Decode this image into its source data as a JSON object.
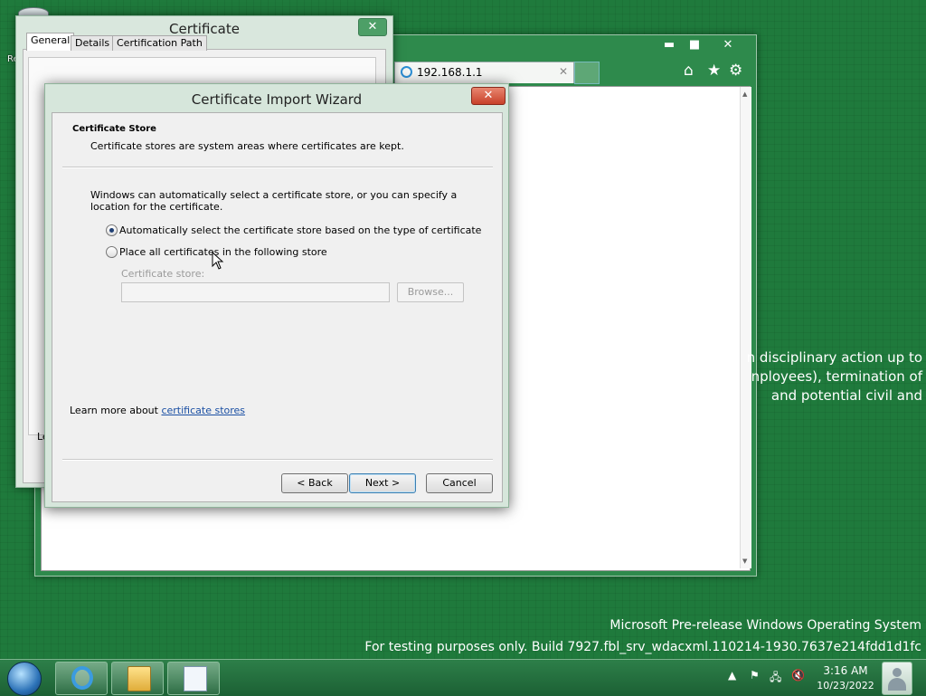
{
  "desktop": {
    "recycle_label": "Re",
    "watermark_line1": "Microsoft Pre-release Windows Operating System",
    "watermark_line2": "For testing purposes only. Build 7927.fbl_srv_wdacxml.110214-1930.7637e214fdd1d1fc"
  },
  "browser": {
    "tab_title": "192.168.1.1",
    "tab_close": "✕",
    "min_glyph": "▬",
    "max_glyph": "■",
    "close_glyph": "✕",
    "home_glyph": "⌂",
    "favorites_glyph": "★",
    "tools_glyph": "⚙",
    "page_text_line1": "n disciplinary action up to",
    "page_text_line2": "nployees), termination of",
    "page_text_line3": "and potential civil and"
  },
  "certificate_window": {
    "title": "Certificate",
    "close_glyph": "✕",
    "tabs": [
      "General",
      "Details",
      "Certification Path"
    ],
    "learn_partial": "Lea"
  },
  "wizard": {
    "title": "Certificate Import Wizard",
    "close_glyph": "✕",
    "heading": "Certificate Store",
    "subheading": "Certificate stores are system areas where certificates are kept.",
    "description": "Windows can automatically select a certificate store, or you can specify a location for the certificate.",
    "option_auto": "Automatically select the certificate store based on the type of certificate",
    "option_manual": "Place all certificates in the following store",
    "selected_option": "auto",
    "store_label": "Certificate store:",
    "store_value": "",
    "browse_label": "Browse...",
    "learn_prefix": "Learn more about ",
    "learn_link": "certificate stores",
    "back_label": "< Back",
    "next_label": "Next >",
    "cancel_label": "Cancel"
  },
  "taskbar": {
    "clock_time": "3:16 AM",
    "clock_date": "10/23/2022",
    "tray_up": "▲",
    "tray_flag": "⚑",
    "tray_network": "🖧",
    "tray_volume": "🔇"
  },
  "colors": {
    "desktop": "#1f7a3c",
    "link": "#1a4fa3",
    "wizard_close": "#c8412a"
  }
}
